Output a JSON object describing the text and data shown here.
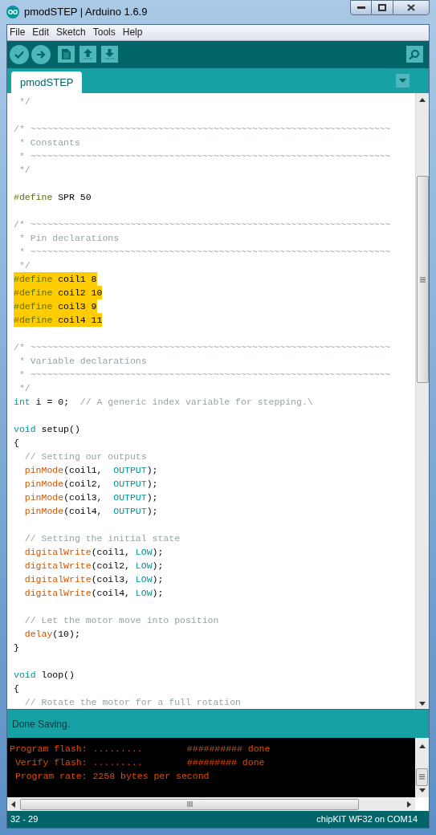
{
  "window": {
    "title": "pmodSTEP | Arduino 1.6.9"
  },
  "menu": [
    "File",
    "Edit",
    "Sketch",
    "Tools",
    "Help"
  ],
  "tabs": [
    {
      "label": "pmodSTEP",
      "selected": true
    }
  ],
  "code_lines": [
    {
      "highlighted": false,
      "tokens": [
        {
          "kind": "comment",
          "text": " */"
        }
      ]
    },
    {
      "kind": "blank"
    },
    {
      "highlighted": false,
      "tokens": [
        {
          "kind": "comment",
          "text": "/* ~~~~~~~~~~~~~~~~~~~~~~~~~~~~~~~~~~~~~~~~~~~~~~~~~~~~~~~~~~~~~~~~~"
        }
      ]
    },
    {
      "highlighted": false,
      "tokens": [
        {
          "kind": "comment",
          "text": " * Constants"
        }
      ]
    },
    {
      "highlighted": false,
      "tokens": [
        {
          "kind": "comment",
          "text": " * ~~~~~~~~~~~~~~~~~~~~~~~~~~~~~~~~~~~~~~~~~~~~~~~~~~~~~~~~~~~~~~~~~"
        }
      ]
    },
    {
      "highlighted": false,
      "tokens": [
        {
          "kind": "comment",
          "text": " */"
        }
      ]
    },
    {
      "kind": "blank"
    },
    {
      "highlighted": false,
      "tokens": [
        {
          "kind": "directive",
          "text": "#define"
        },
        {
          "kind": "plain",
          "text": " SPR 50"
        }
      ]
    },
    {
      "kind": "blank"
    },
    {
      "highlighted": false,
      "tokens": [
        {
          "kind": "comment",
          "text": "/* ~~~~~~~~~~~~~~~~~~~~~~~~~~~~~~~~~~~~~~~~~~~~~~~~~~~~~~~~~~~~~~~~~"
        }
      ]
    },
    {
      "highlighted": false,
      "tokens": [
        {
          "kind": "comment",
          "text": " * Pin declarations"
        }
      ]
    },
    {
      "highlighted": false,
      "tokens": [
        {
          "kind": "comment",
          "text": " * ~~~~~~~~~~~~~~~~~~~~~~~~~~~~~~~~~~~~~~~~~~~~~~~~~~~~~~~~~~~~~~~~~"
        }
      ]
    },
    {
      "highlighted": false,
      "tokens": [
        {
          "kind": "comment",
          "text": " */"
        }
      ]
    },
    {
      "highlighted": true,
      "tokens": [
        {
          "kind": "directive",
          "text": "#define"
        },
        {
          "kind": "plain",
          "text": " coil1 8"
        }
      ]
    },
    {
      "highlighted": true,
      "tokens": [
        {
          "kind": "directive",
          "text": "#define"
        },
        {
          "kind": "plain",
          "text": " coil2 10"
        }
      ]
    },
    {
      "highlighted": true,
      "tokens": [
        {
          "kind": "directive",
          "text": "#define"
        },
        {
          "kind": "plain",
          "text": " coil3 9"
        }
      ]
    },
    {
      "highlighted": true,
      "tokens": [
        {
          "kind": "directive",
          "text": "#define"
        },
        {
          "kind": "plain",
          "text": " coil4 11"
        }
      ]
    },
    {
      "kind": "blank"
    },
    {
      "highlighted": false,
      "tokens": [
        {
          "kind": "comment",
          "text": "/* ~~~~~~~~~~~~~~~~~~~~~~~~~~~~~~~~~~~~~~~~~~~~~~~~~~~~~~~~~~~~~~~~~"
        }
      ]
    },
    {
      "highlighted": false,
      "tokens": [
        {
          "kind": "comment",
          "text": " * Variable declarations"
        }
      ]
    },
    {
      "highlighted": false,
      "tokens": [
        {
          "kind": "comment",
          "text": " * ~~~~~~~~~~~~~~~~~~~~~~~~~~~~~~~~~~~~~~~~~~~~~~~~~~~~~~~~~~~~~~~~~"
        }
      ]
    },
    {
      "highlighted": false,
      "tokens": [
        {
          "kind": "comment",
          "text": " */"
        }
      ]
    },
    {
      "highlighted": false,
      "tokens": [
        {
          "kind": "keyword",
          "text": "int"
        },
        {
          "kind": "plain",
          "text": " i = 0;  "
        },
        {
          "kind": "comment",
          "text": "// A generic index variable for stepping.\\"
        }
      ]
    },
    {
      "kind": "blank"
    },
    {
      "highlighted": false,
      "tokens": [
        {
          "kind": "keyword",
          "text": "void"
        },
        {
          "kind": "plain",
          "text": " setup()"
        }
      ]
    },
    {
      "highlighted": false,
      "tokens": [
        {
          "kind": "plain",
          "text": "{"
        }
      ]
    },
    {
      "highlighted": false,
      "tokens": [
        {
          "kind": "comment",
          "text": "  // Setting our outputs"
        }
      ]
    },
    {
      "highlighted": false,
      "tokens": [
        {
          "kind": "function",
          "text": "  pinMode"
        },
        {
          "kind": "plain",
          "text": "(coil1,  "
        },
        {
          "kind": "constant",
          "text": "OUTPUT"
        },
        {
          "kind": "plain",
          "text": ");"
        }
      ]
    },
    {
      "highlighted": false,
      "tokens": [
        {
          "kind": "function",
          "text": "  pinMode"
        },
        {
          "kind": "plain",
          "text": "(coil2,  "
        },
        {
          "kind": "constant",
          "text": "OUTPUT"
        },
        {
          "kind": "plain",
          "text": ");"
        }
      ]
    },
    {
      "highlighted": false,
      "tokens": [
        {
          "kind": "function",
          "text": "  pinMode"
        },
        {
          "kind": "plain",
          "text": "(coil3,  "
        },
        {
          "kind": "constant",
          "text": "OUTPUT"
        },
        {
          "kind": "plain",
          "text": ");"
        }
      ]
    },
    {
      "highlighted": false,
      "tokens": [
        {
          "kind": "function",
          "text": "  pinMode"
        },
        {
          "kind": "plain",
          "text": "(coil4,  "
        },
        {
          "kind": "constant",
          "text": "OUTPUT"
        },
        {
          "kind": "plain",
          "text": ");"
        }
      ]
    },
    {
      "kind": "blank"
    },
    {
      "highlighted": false,
      "tokens": [
        {
          "kind": "comment",
          "text": "  // Setting the initial state"
        }
      ]
    },
    {
      "highlighted": false,
      "tokens": [
        {
          "kind": "function",
          "text": "  digitalWrite"
        },
        {
          "kind": "plain",
          "text": "(coil1, "
        },
        {
          "kind": "constant",
          "text": "LOW"
        },
        {
          "kind": "plain",
          "text": ");"
        }
      ]
    },
    {
      "highlighted": false,
      "tokens": [
        {
          "kind": "function",
          "text": "  digitalWrite"
        },
        {
          "kind": "plain",
          "text": "(coil2, "
        },
        {
          "kind": "constant",
          "text": "LOW"
        },
        {
          "kind": "plain",
          "text": ");"
        }
      ]
    },
    {
      "highlighted": false,
      "tokens": [
        {
          "kind": "function",
          "text": "  digitalWrite"
        },
        {
          "kind": "plain",
          "text": "(coil3, "
        },
        {
          "kind": "constant",
          "text": "LOW"
        },
        {
          "kind": "plain",
          "text": ");"
        }
      ]
    },
    {
      "highlighted": false,
      "tokens": [
        {
          "kind": "function",
          "text": "  digitalWrite"
        },
        {
          "kind": "plain",
          "text": "(coil4, "
        },
        {
          "kind": "constant",
          "text": "LOW"
        },
        {
          "kind": "plain",
          "text": ");"
        }
      ]
    },
    {
      "kind": "blank"
    },
    {
      "highlighted": false,
      "tokens": [
        {
          "kind": "comment",
          "text": "  // Let the motor move into position"
        }
      ]
    },
    {
      "highlighted": false,
      "tokens": [
        {
          "kind": "function",
          "text": "  delay"
        },
        {
          "kind": "plain",
          "text": "(10);"
        }
      ]
    },
    {
      "highlighted": false,
      "tokens": [
        {
          "kind": "plain",
          "text": "}"
        }
      ]
    },
    {
      "kind": "blank"
    },
    {
      "highlighted": false,
      "tokens": [
        {
          "kind": "keyword",
          "text": "void"
        },
        {
          "kind": "plain",
          "text": " loop()"
        }
      ]
    },
    {
      "highlighted": false,
      "tokens": [
        {
          "kind": "plain",
          "text": "{"
        }
      ]
    },
    {
      "highlighted": false,
      "tokens": [
        {
          "kind": "comment",
          "text": "  // Rotate the motor for a full rotation"
        }
      ]
    }
  ],
  "status_message": "Done Saving.",
  "console_lines": [
    "Program flash: .........        ########## done",
    " Verify flash: .........        ######### done",
    " Program rate: 2258 bytes per second"
  ],
  "status_bar": {
    "position": "32 - 29",
    "board": "chipKIT WF32 on COM14"
  }
}
